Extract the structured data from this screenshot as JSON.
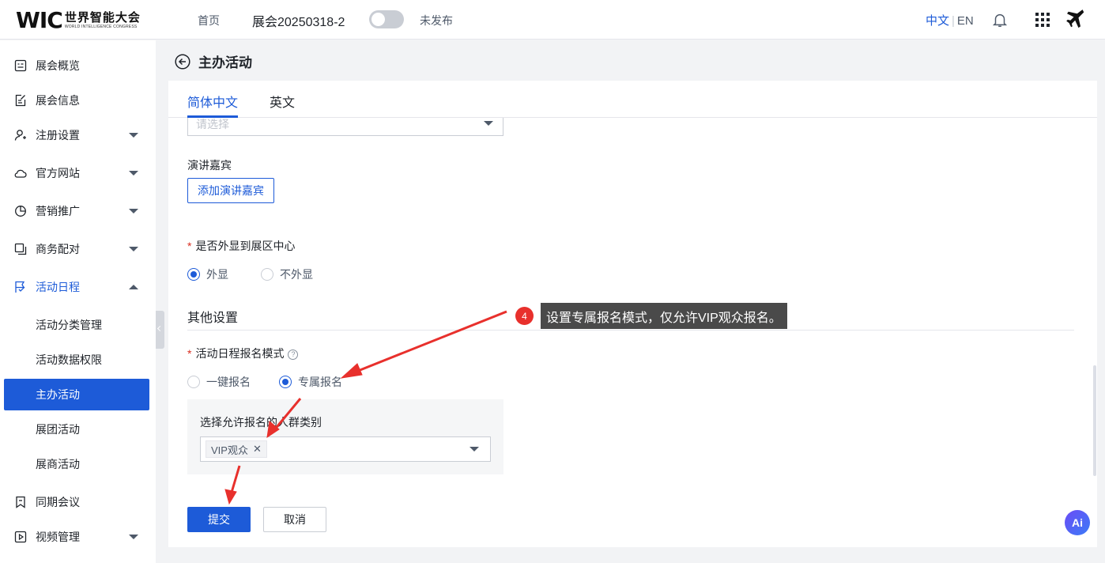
{
  "topbar": {
    "logo_mark": "WIC",
    "logo_cn": "世界智能大会",
    "logo_en": "WORLD INTELLIGENCE CONGRESS",
    "home": "首页",
    "expo_name": "展会20250318-2",
    "publish_status": "未发布",
    "lang_cn": "中文",
    "lang_sep": "|",
    "lang_en": "EN",
    "icons": [
      "bell-icon",
      "apps-grid-icon",
      "plane-icon"
    ]
  },
  "sidebar": {
    "items": [
      {
        "label": "展会概览",
        "icon": "overview-icon"
      },
      {
        "label": "展会信息",
        "icon": "edit-doc-icon"
      },
      {
        "label": "注册设置",
        "icon": "user-add-icon"
      },
      {
        "label": "官方网站",
        "icon": "cloud-icon"
      },
      {
        "label": "营销推广",
        "icon": "pie-icon"
      },
      {
        "label": "商务配对",
        "icon": "copy-icon"
      },
      {
        "label": "活动日程",
        "icon": "flag-icon"
      },
      {
        "label": "同期会议",
        "icon": "bookmark-icon"
      },
      {
        "label": "视频管理",
        "icon": "video-icon"
      }
    ],
    "sub_items": [
      {
        "label": "活动分类管理"
      },
      {
        "label": "活动数据权限"
      },
      {
        "label": "主办活动"
      },
      {
        "label": "展团活动"
      },
      {
        "label": "展商活动"
      }
    ]
  },
  "page": {
    "title": "主办活动",
    "tabs": [
      "简体中文",
      "英文"
    ],
    "select_placeholder": "请选择",
    "speakers_label": "演讲嘉宾",
    "add_speaker_button": "添加演讲嘉宾",
    "show_outside_label": "是否外显到展区中心",
    "show_outside_options": [
      "外显",
      "不外显"
    ],
    "show_outside_selected": "外显",
    "other_settings_title": "其他设置",
    "signup_mode_label": "活动日程报名模式",
    "signup_mode_help": "?",
    "signup_mode_options": [
      "一键报名",
      "专属报名"
    ],
    "signup_mode_selected": "专属报名",
    "audience_label": "选择允许报名的人群类别",
    "audience_selected_tag": "VIP观众",
    "audience_tag_remove": "✕",
    "submit_button": "提交",
    "cancel_button": "取消"
  },
  "annotation": {
    "step": "4",
    "text": "设置专属报名模式，仅允许VIP观众报名。",
    "color": "#e8302c"
  },
  "ai_button": "Ai",
  "colors": {
    "primary": "#1d5bd8",
    "annotation_red": "#e8302c"
  }
}
